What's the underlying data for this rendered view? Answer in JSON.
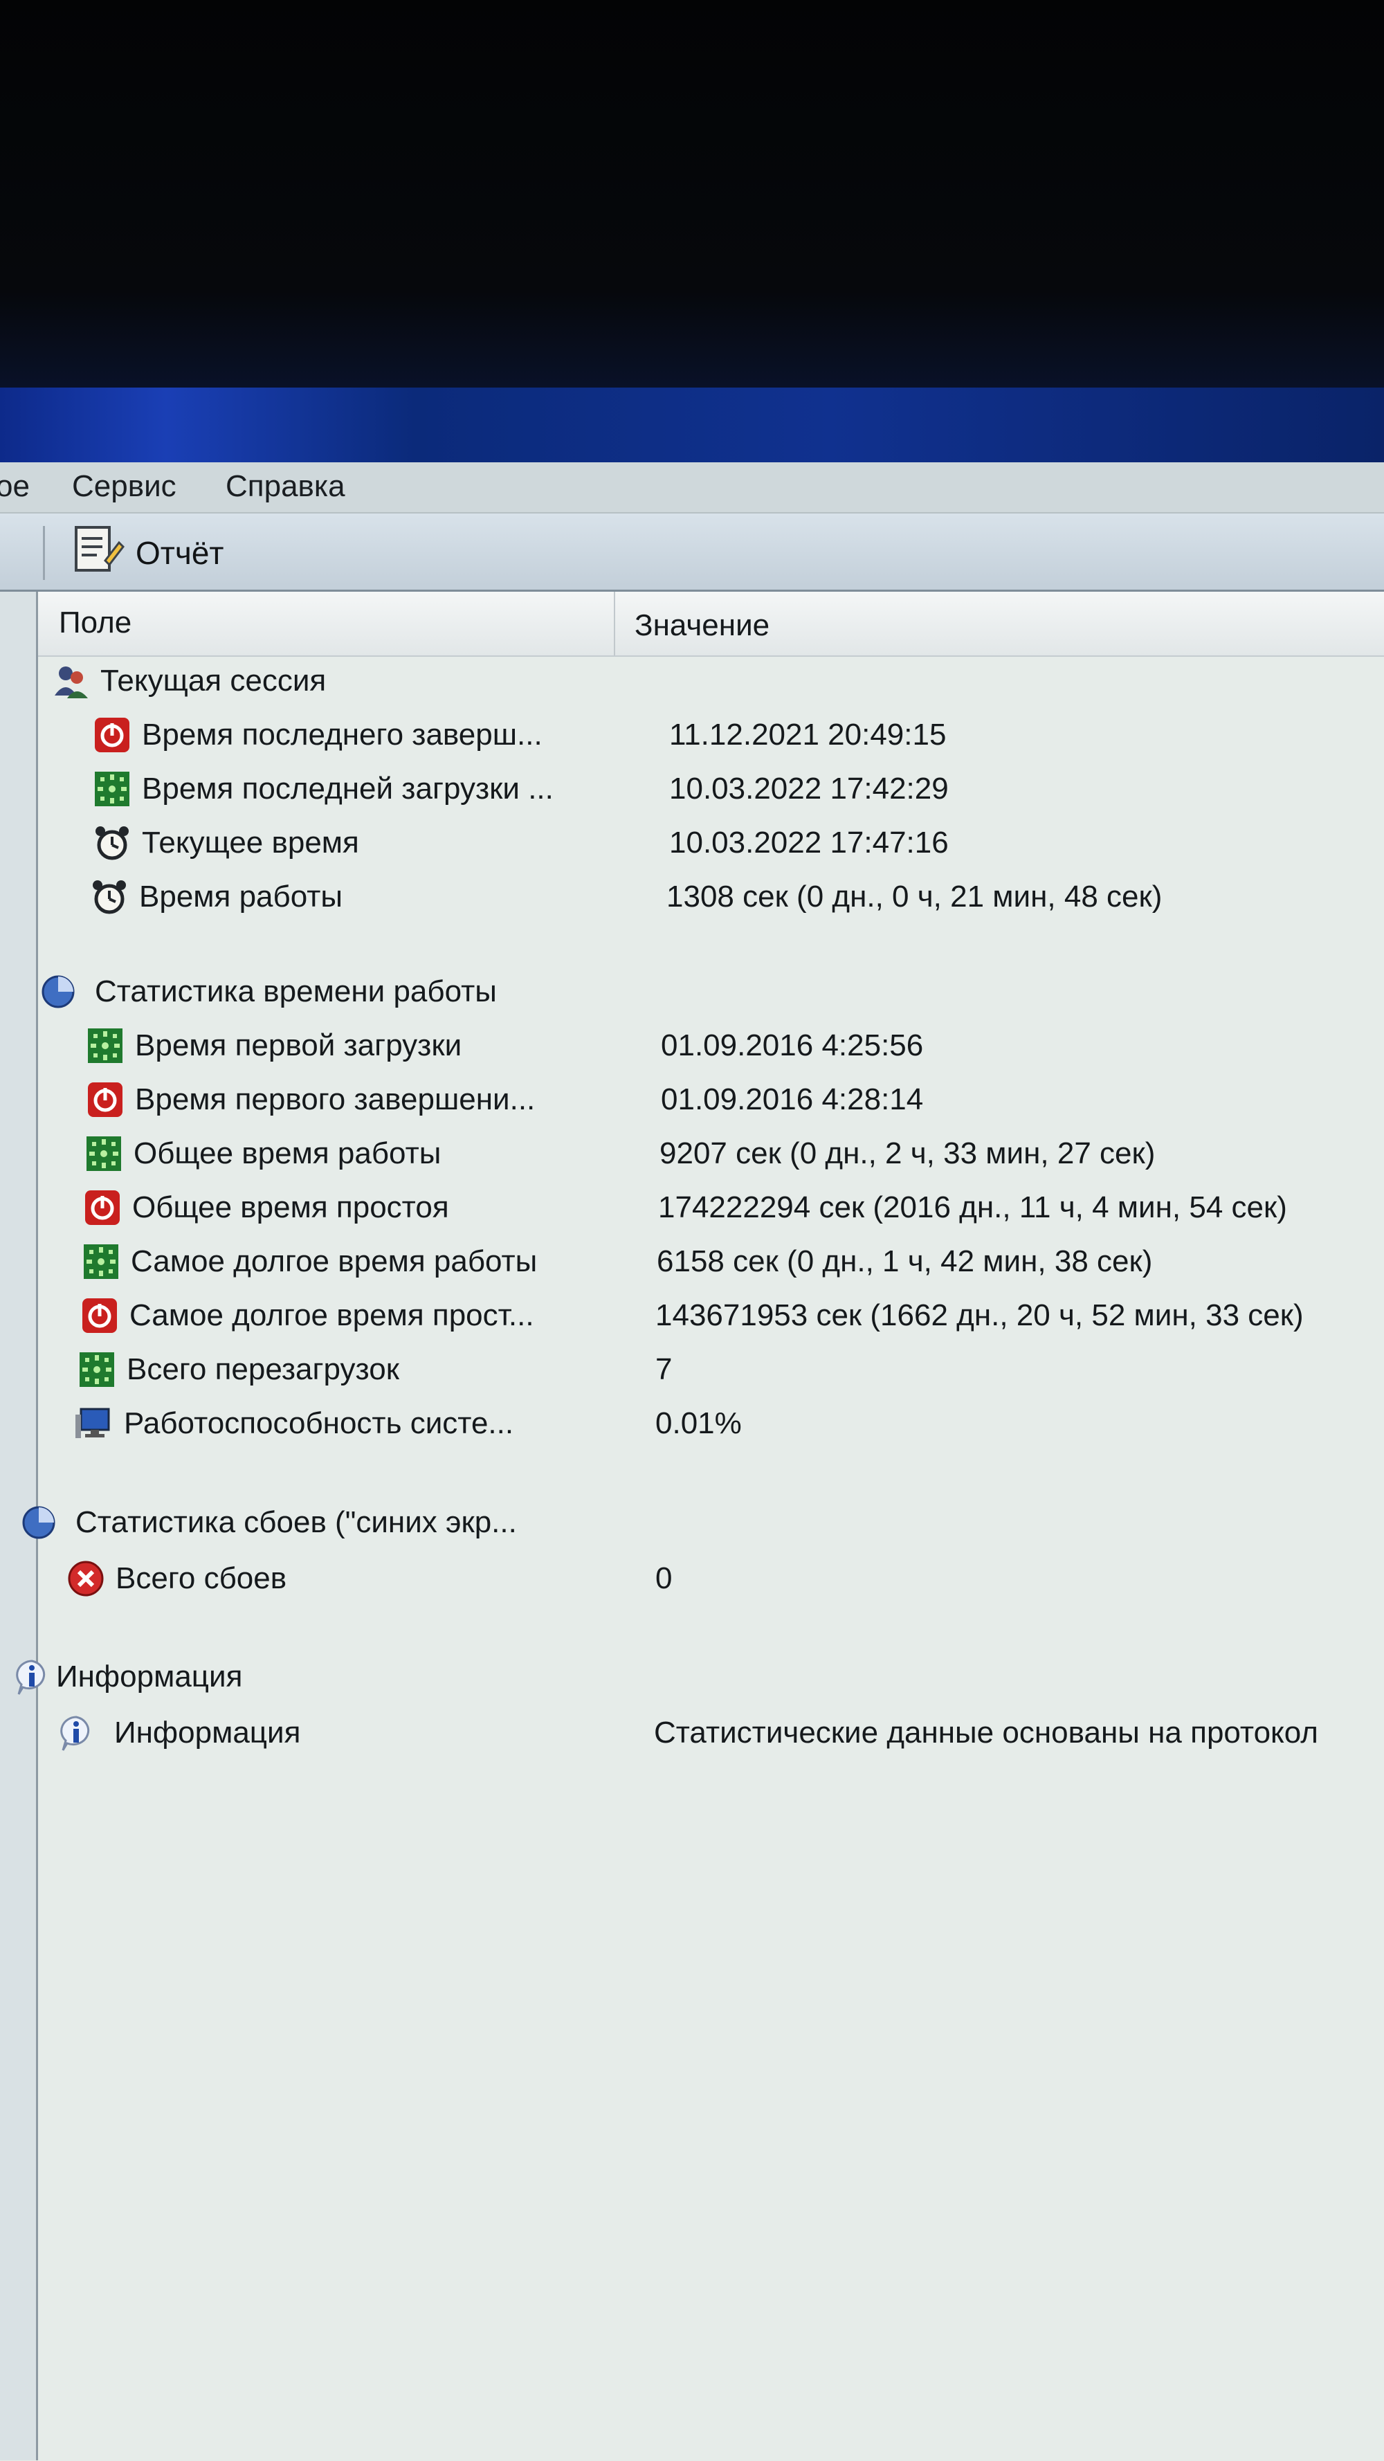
{
  "menu": {
    "items": [
      {
        "label": "ое"
      },
      {
        "label": "Сервис"
      },
      {
        "label": "Справка"
      }
    ]
  },
  "toolbar": {
    "report_label": "Отчёт"
  },
  "columns": {
    "field": "Поле",
    "value": "Значение"
  },
  "sections": {
    "current_session": {
      "title": "Текущая сессия",
      "rows": [
        {
          "icon": "shutdown-icon",
          "label": "Время последнего заверш...",
          "value": "11.12.2021 20:49:15"
        },
        {
          "icon": "boot-icon",
          "label": "Время последней загрузки ...",
          "value": "10.03.2022 17:42:29"
        },
        {
          "icon": "alarm-clock-icon",
          "label": "Текущее время",
          "value": "10.03.2022 17:47:16"
        },
        {
          "icon": "alarm-clock-icon",
          "label": "Время работы",
          "value": "1308 сек (0 дн., 0 ч, 21 мин, 48 сек)"
        }
      ]
    },
    "uptime_stats": {
      "title": "Статистика времени работы",
      "rows": [
        {
          "icon": "boot-icon",
          "label": "Время первой загрузки",
          "value": "01.09.2016 4:25:56"
        },
        {
          "icon": "shutdown-icon",
          "label": "Время первого завершени...",
          "value": "01.09.2016 4:28:14"
        },
        {
          "icon": "boot-icon",
          "label": "Общее время работы",
          "value": "9207 сек (0 дн., 2 ч, 33 мин, 27 сек)"
        },
        {
          "icon": "shutdown-icon",
          "label": "Общее время простоя",
          "value": "174222294 сек (2016 дн., 11 ч, 4 мин, 54 сек)"
        },
        {
          "icon": "boot-icon",
          "label": "Самое долгое время работы",
          "value": "6158 сек (0 дн., 1 ч, 42 мин, 38 сек)"
        },
        {
          "icon": "shutdown-icon",
          "label": "Самое долгое время прост...",
          "value": "143671953 сек (1662 дн., 20 ч, 52 мин, 33 сек)"
        },
        {
          "icon": "boot-icon",
          "label": "Всего перезагрузок",
          "value": "7"
        },
        {
          "icon": "computer-icon",
          "label": "Работоспособность систе...",
          "value": "0.01%"
        }
      ]
    },
    "crash_stats": {
      "title": "Статистика сбоев (\"синих экр...",
      "rows": [
        {
          "icon": "error-icon",
          "label": "Всего сбоев",
          "value": "0"
        }
      ]
    },
    "information": {
      "title": "Информация",
      "rows": [
        {
          "icon": "info-icon",
          "label": "Информация",
          "value": "Статистические данные основаны на протокол"
        }
      ]
    }
  }
}
